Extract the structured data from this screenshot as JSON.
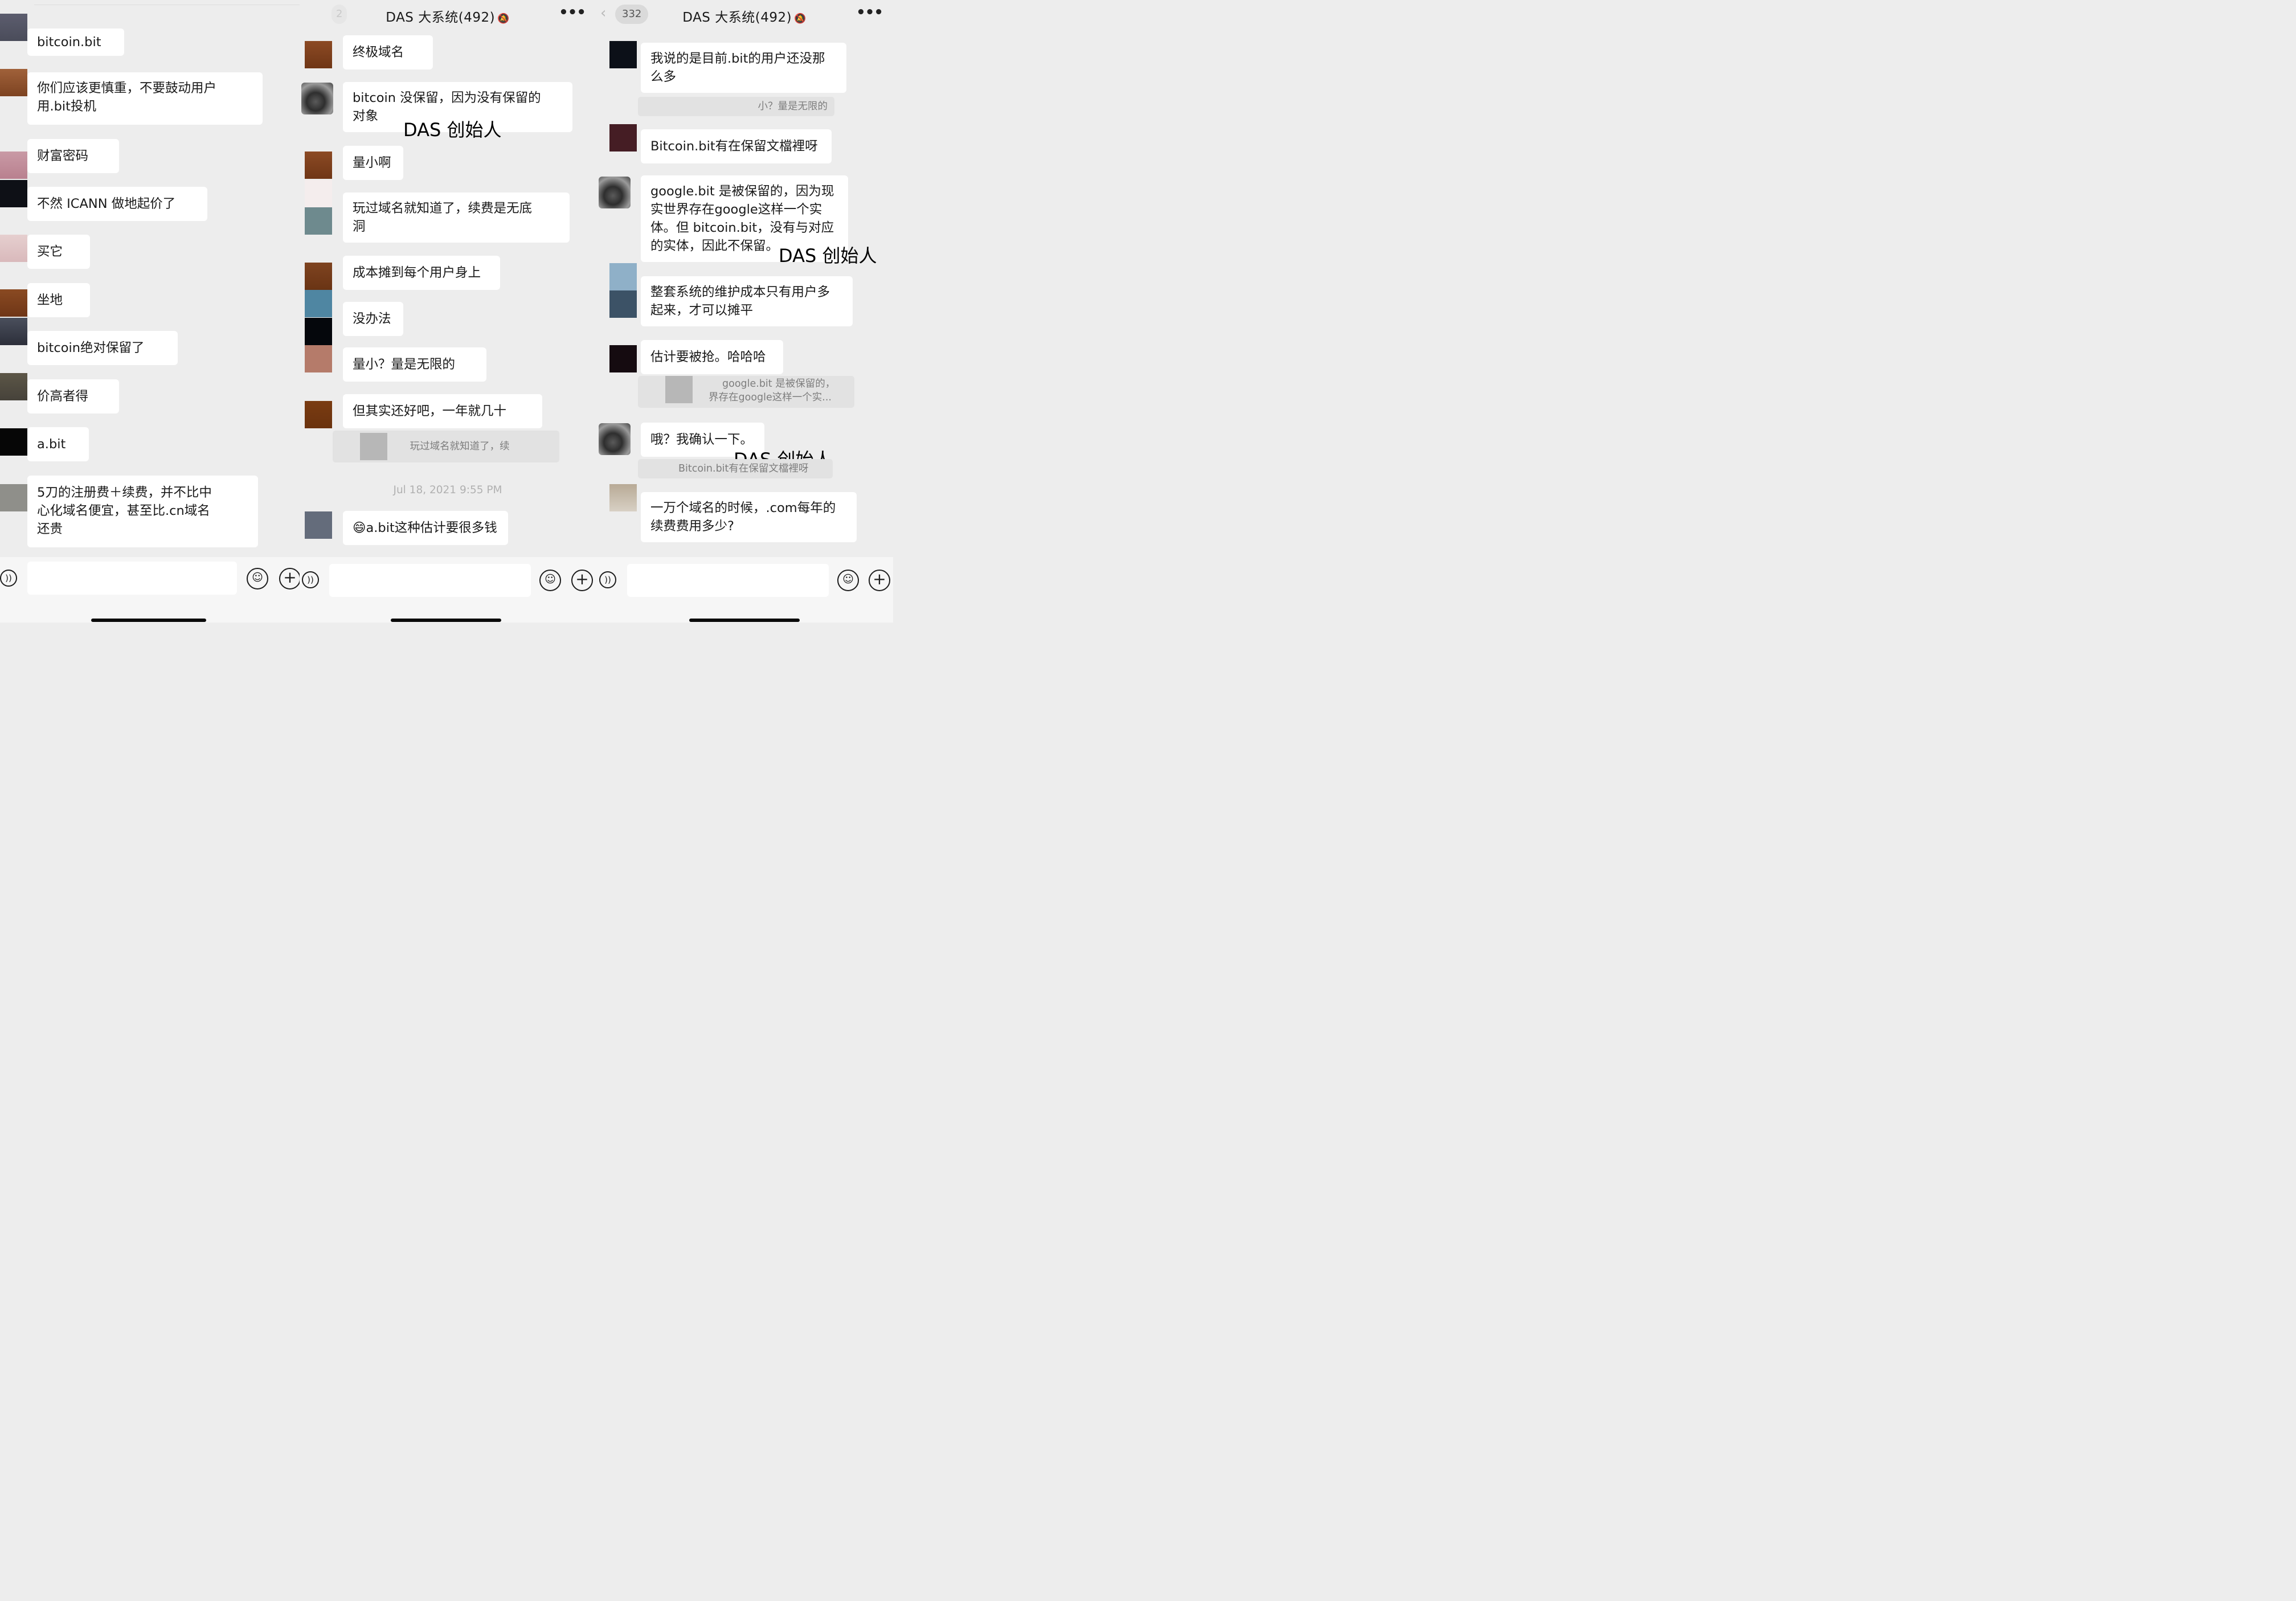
{
  "panel1": {
    "messages": [
      "bitcoin.bit",
      "你们应该更慎重，不要鼓动用户",
      "用.bit投机",
      "财富密码",
      "不然 ICANN 做地起价了",
      "买它",
      "坐地",
      "bitcoin绝对保留了",
      "价高者得",
      "a.bit",
      "5刀的注册费＋续费，并不比中",
      "心化域名便宜，甚至比.cn域名",
      "还贵"
    ]
  },
  "panel2": {
    "back_count": "2",
    "title": "DAS 大系统(492)",
    "messages": [
      "终极域名",
      "bitcoin 没保留，因为没有保留的",
      "对象",
      "量小啊",
      "玩过域名就知道了，续费是无底",
      "洞",
      "成本摊到每个用户身上",
      "没办法",
      "量小？量是无限的",
      "但其实还好吧，一年就几十",
      "a.bit这种估计要很多钱"
    ],
    "emoji": "😄",
    "quote": "玩过域名就知道了，续",
    "timestamp": "Jul 18, 2021 9:55 PM",
    "overlay": "DAS 创始人"
  },
  "panel3": {
    "back_count": "332",
    "title": "DAS 大系统(492)",
    "messages": [
      "我说的是目前.bit的用户还没那",
      "么多",
      "Bitcoin.bit有在保留文檔裡呀",
      "google.bit 是被保留的，因为现",
      "实世界存在google这样一个实",
      "体。但 bitcoin.bit，没有与对应",
      "的实体，因此不保留。",
      "整套系统的维护成本只有用户多",
      "起来，才可以摊平",
      "估计要被抢。哈哈哈",
      "哦？我确认一下。",
      "一万个域名的时候，.com每年的",
      "续费费用多少?"
    ],
    "quotes": [
      "小？量是无限的",
      "google.bit 是被保留的，",
      "界存在google这样一个实...",
      "Bitcoin.bit有在保留文檔裡呀"
    ],
    "overlays": [
      "DAS 创始人",
      "DAS 创始人"
    ]
  },
  "icons": {
    "mute": "🔕",
    "more": "•••",
    "back": "‹",
    "voice": "🔊",
    "emoji": "☺",
    "plus": "+"
  },
  "colors": {
    "background": "#ededed",
    "bubble": "#ffffff",
    "quote_bg": "#e2e2e2"
  }
}
